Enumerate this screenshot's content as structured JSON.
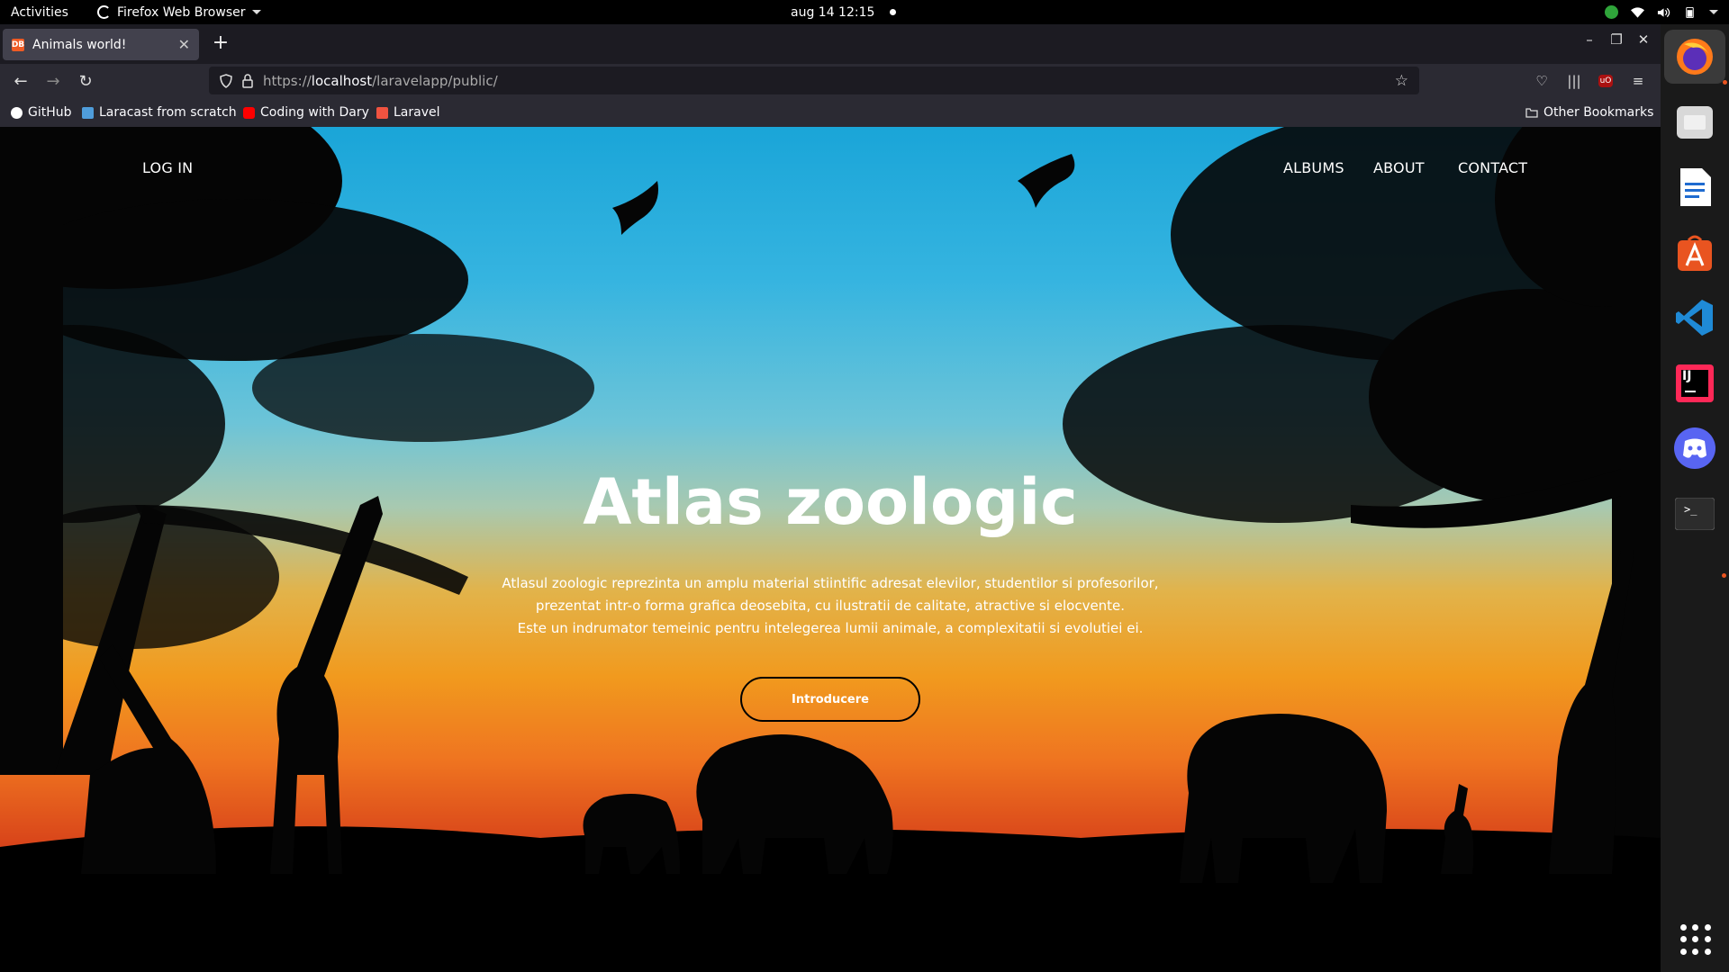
{
  "system": {
    "activities": "Activities",
    "app_name": "Firefox Web Browser",
    "clock": "aug 14  12:15"
  },
  "browser": {
    "tab_title": "Animals world!",
    "tab_favicon_text": "DB",
    "url_prefix": "https://",
    "url_host": "localhost",
    "url_path": "/laravelapp/public/",
    "bookmarks": [
      {
        "label": "GitHub",
        "icon": "github-icon"
      },
      {
        "label": "Laracast from scratch",
        "icon": "laracast-icon"
      },
      {
        "label": "Coding with Dary",
        "icon": "youtube-icon"
      },
      {
        "label": "Laravel",
        "icon": "laravel-icon"
      }
    ],
    "other_bookmarks": "Other Bookmarks"
  },
  "page": {
    "nav": {
      "login": "LOG IN",
      "albums": "ALBUMS",
      "about": "ABOUT",
      "contact": "CONTACT"
    },
    "hero": {
      "title": "Atlas zoologic",
      "lines": [
        "Atlasul zoologic reprezinta un amplu material stiintific adresat elevilor, studentilor si profesorilor,",
        "prezentat intr-o forma grafica deosebita, cu ilustratii de calitate, atractive si elocvente.",
        "Este un indrumator temeinic pentru intelegerea lumii animale, a complexitatii si evolutiei ei."
      ],
      "button": "Introducere"
    }
  },
  "dock": {
    "apps": [
      "firefox-icon",
      "files-icon",
      "writer-icon",
      "software-center-icon",
      "vscode-icon",
      "intellij-icon",
      "discord-icon",
      "terminal-icon"
    ],
    "intellij_text": "IJ",
    "terminal_text": ">_"
  },
  "colors": {
    "sky_top": "#1aa5d8",
    "sunset_orange": "#f19a1e",
    "sunset_red": "#d8441a",
    "ubuntu_orange": "#e95420"
  }
}
